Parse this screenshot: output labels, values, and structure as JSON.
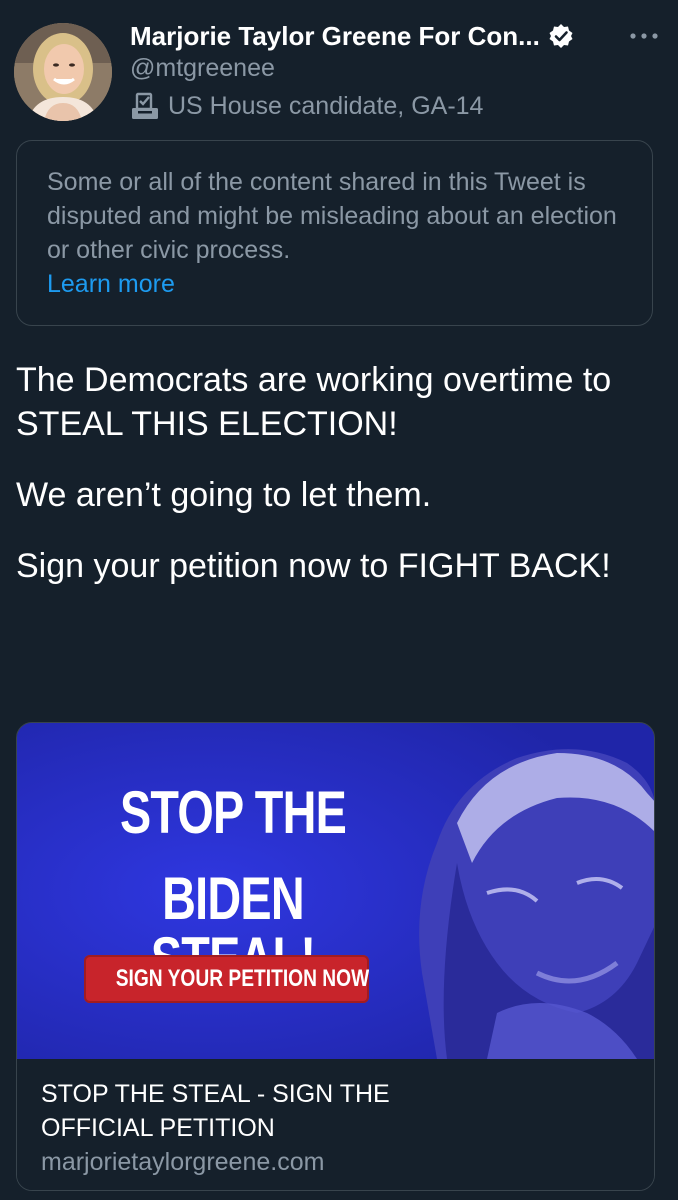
{
  "author": {
    "display_name": "Marjorie Taylor Greene For Con...",
    "handle": "@mtgreenee",
    "label": "US House candidate, GA-14"
  },
  "notice": {
    "text": "Some or all of the content shared in this Tweet is disputed and might be misleading about an election or other civic process.",
    "link": "Learn more"
  },
  "tweet": {
    "paragraphs": [
      "The Democrats are working overtime to STEAL THIS ELECTION!",
      "We aren’t going to let them.",
      "Sign your petition now to FIGHT BACK!"
    ]
  },
  "card": {
    "image_headline_1": "STOP THE",
    "image_headline_2": "BIDEN STEAL!",
    "image_button": "SIGN YOUR PETITION NOW",
    "title": "STOP THE STEAL - SIGN THE OFFICIAL PETITION",
    "domain": "marjorietaylorgreene.com"
  },
  "colors": {
    "background": "#15202b",
    "border": "#38444d",
    "secondary_text": "#8b98a5",
    "link": "#1d9bf0",
    "card_image_blue": "#2a2fc9",
    "button_red": "#c8242b"
  },
  "icons": [
    "verified-icon",
    "more-icon",
    "ballot-box-icon"
  ]
}
